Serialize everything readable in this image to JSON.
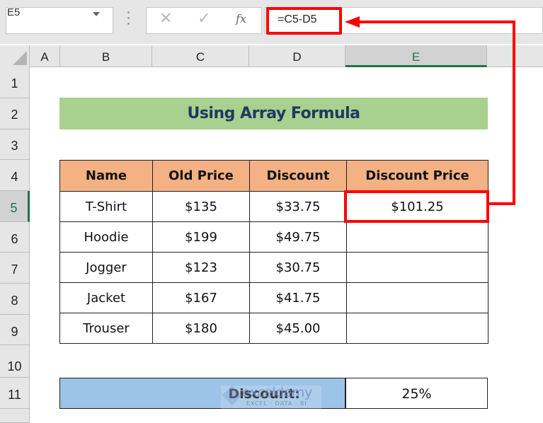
{
  "formula_bar": {
    "name_box": "E5",
    "cancel_icon": "✕",
    "enter_icon": "✓",
    "fx_label": "fx",
    "formula": "=C5-D5"
  },
  "columns": [
    "A",
    "B",
    "C",
    "D",
    "E"
  ],
  "selected_column": "E",
  "rows": [
    "1",
    "2",
    "3",
    "4",
    "5",
    "6",
    "7",
    "8",
    "9",
    "10",
    "11"
  ],
  "selected_row": "5",
  "title": "Using Array Formula",
  "table": {
    "headers": [
      "Name",
      "Old Price",
      "Discount",
      "Discount Price"
    ],
    "rows": [
      [
        "T-Shirt",
        "$135",
        "$33.75",
        "$101.25"
      ],
      [
        "Hoodie",
        "$199",
        "$49.75",
        ""
      ],
      [
        "Jogger",
        "$123",
        "$30.75",
        ""
      ],
      [
        "Jacket",
        "$167",
        "$41.75",
        ""
      ],
      [
        "Trouser",
        "$180",
        "$45.00",
        ""
      ]
    ]
  },
  "summary": {
    "label": "Discount:",
    "value": "25%"
  },
  "watermark": {
    "name": "exceldemy",
    "tagline": "EXCEL · DATA · BI"
  },
  "colors": {
    "highlight": "#ff0000",
    "title_fill": "#a9d08e",
    "header_fill": "#f4b183",
    "summary_fill": "#9dc3e6",
    "selection": "#217346"
  }
}
